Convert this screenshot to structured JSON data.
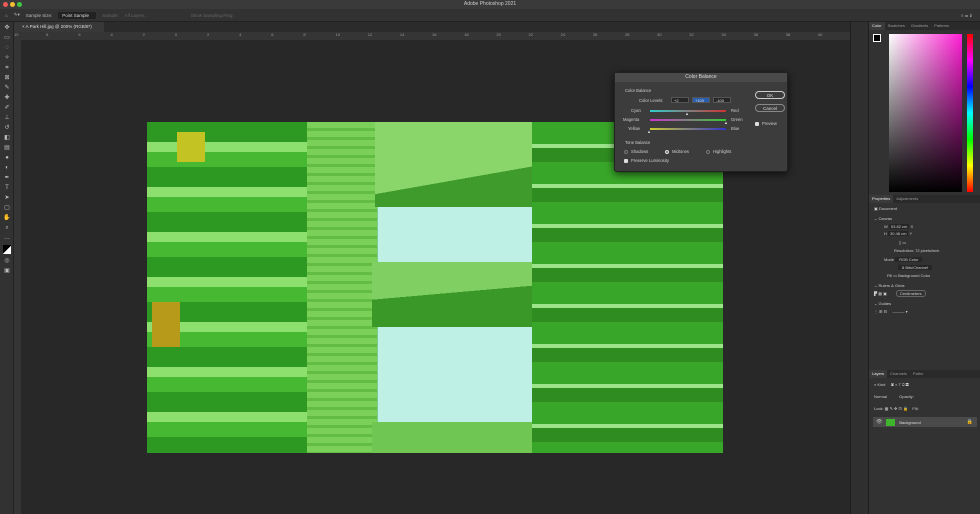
{
  "app": {
    "title": "Adobe Photoshop 2021"
  },
  "options": {
    "sample_size_label": "Sample Size:",
    "sample_size_value": "Point Sample",
    "sample_label": "Sample:",
    "sample_value": "All Layers",
    "sampling_ring": "Show Sampling Ring"
  },
  "document": {
    "tab": "A Park Hill.jpg @ 200% (RGB/8*)"
  },
  "ruler": [
    "10",
    "8",
    "6",
    "4",
    "2",
    "0",
    "2",
    "4",
    "6",
    "8",
    "10",
    "12",
    "14",
    "16",
    "18",
    "20",
    "22",
    "24",
    "26",
    "28",
    "30",
    "32",
    "34",
    "36",
    "38",
    "40"
  ],
  "dialog": {
    "title": "Color Balance",
    "section": "Color Balance",
    "levels_label": "Color Levels:",
    "levels": [
      "+2",
      "+100",
      "-100"
    ],
    "sliders": [
      {
        "left": "Cyan",
        "right": "Red",
        "value": 2
      },
      {
        "left": "Magenta",
        "right": "Green",
        "value": 100
      },
      {
        "left": "Yellow",
        "right": "Blue",
        "value": -100
      }
    ],
    "tone_label": "Tone Balance",
    "tones": [
      "Shadows",
      "Midtones",
      "Highlights"
    ],
    "selected_tone": "Midtones",
    "preserve": "Preserve Luminosity",
    "ok": "OK",
    "cancel": "Cancel",
    "preview": "Preview"
  },
  "color_panel": {
    "tabs": [
      "Color",
      "Swatches",
      "Gradients",
      "Patterns"
    ]
  },
  "properties": {
    "tabs": [
      "Properties",
      "Adjustments"
    ],
    "doc_label": "Document",
    "canvas": "Canvas",
    "w_label": "W",
    "w": "53.82 cm",
    "h_label": "H",
    "h": "30.48 cm",
    "x_label": "X",
    "y_label": "Y",
    "resolution": "Resolution: 72 pixels/inch",
    "mode_label": "Mode",
    "mode": "RGB Color",
    "depth": "8 Bits/Channel",
    "fill_label": "Fill",
    "fill": "Background Color",
    "rulers": "Rulers & Grids",
    "units": "Centimeters",
    "guides": "Guides"
  },
  "layers": {
    "tabs": [
      "Layers",
      "Channels",
      "Paths"
    ],
    "kind": "Kind",
    "blend": "Normal",
    "opacity_label": "Opacity:",
    "lock_label": "Lock:",
    "fill_label": "Fill:",
    "layer": "Background"
  }
}
